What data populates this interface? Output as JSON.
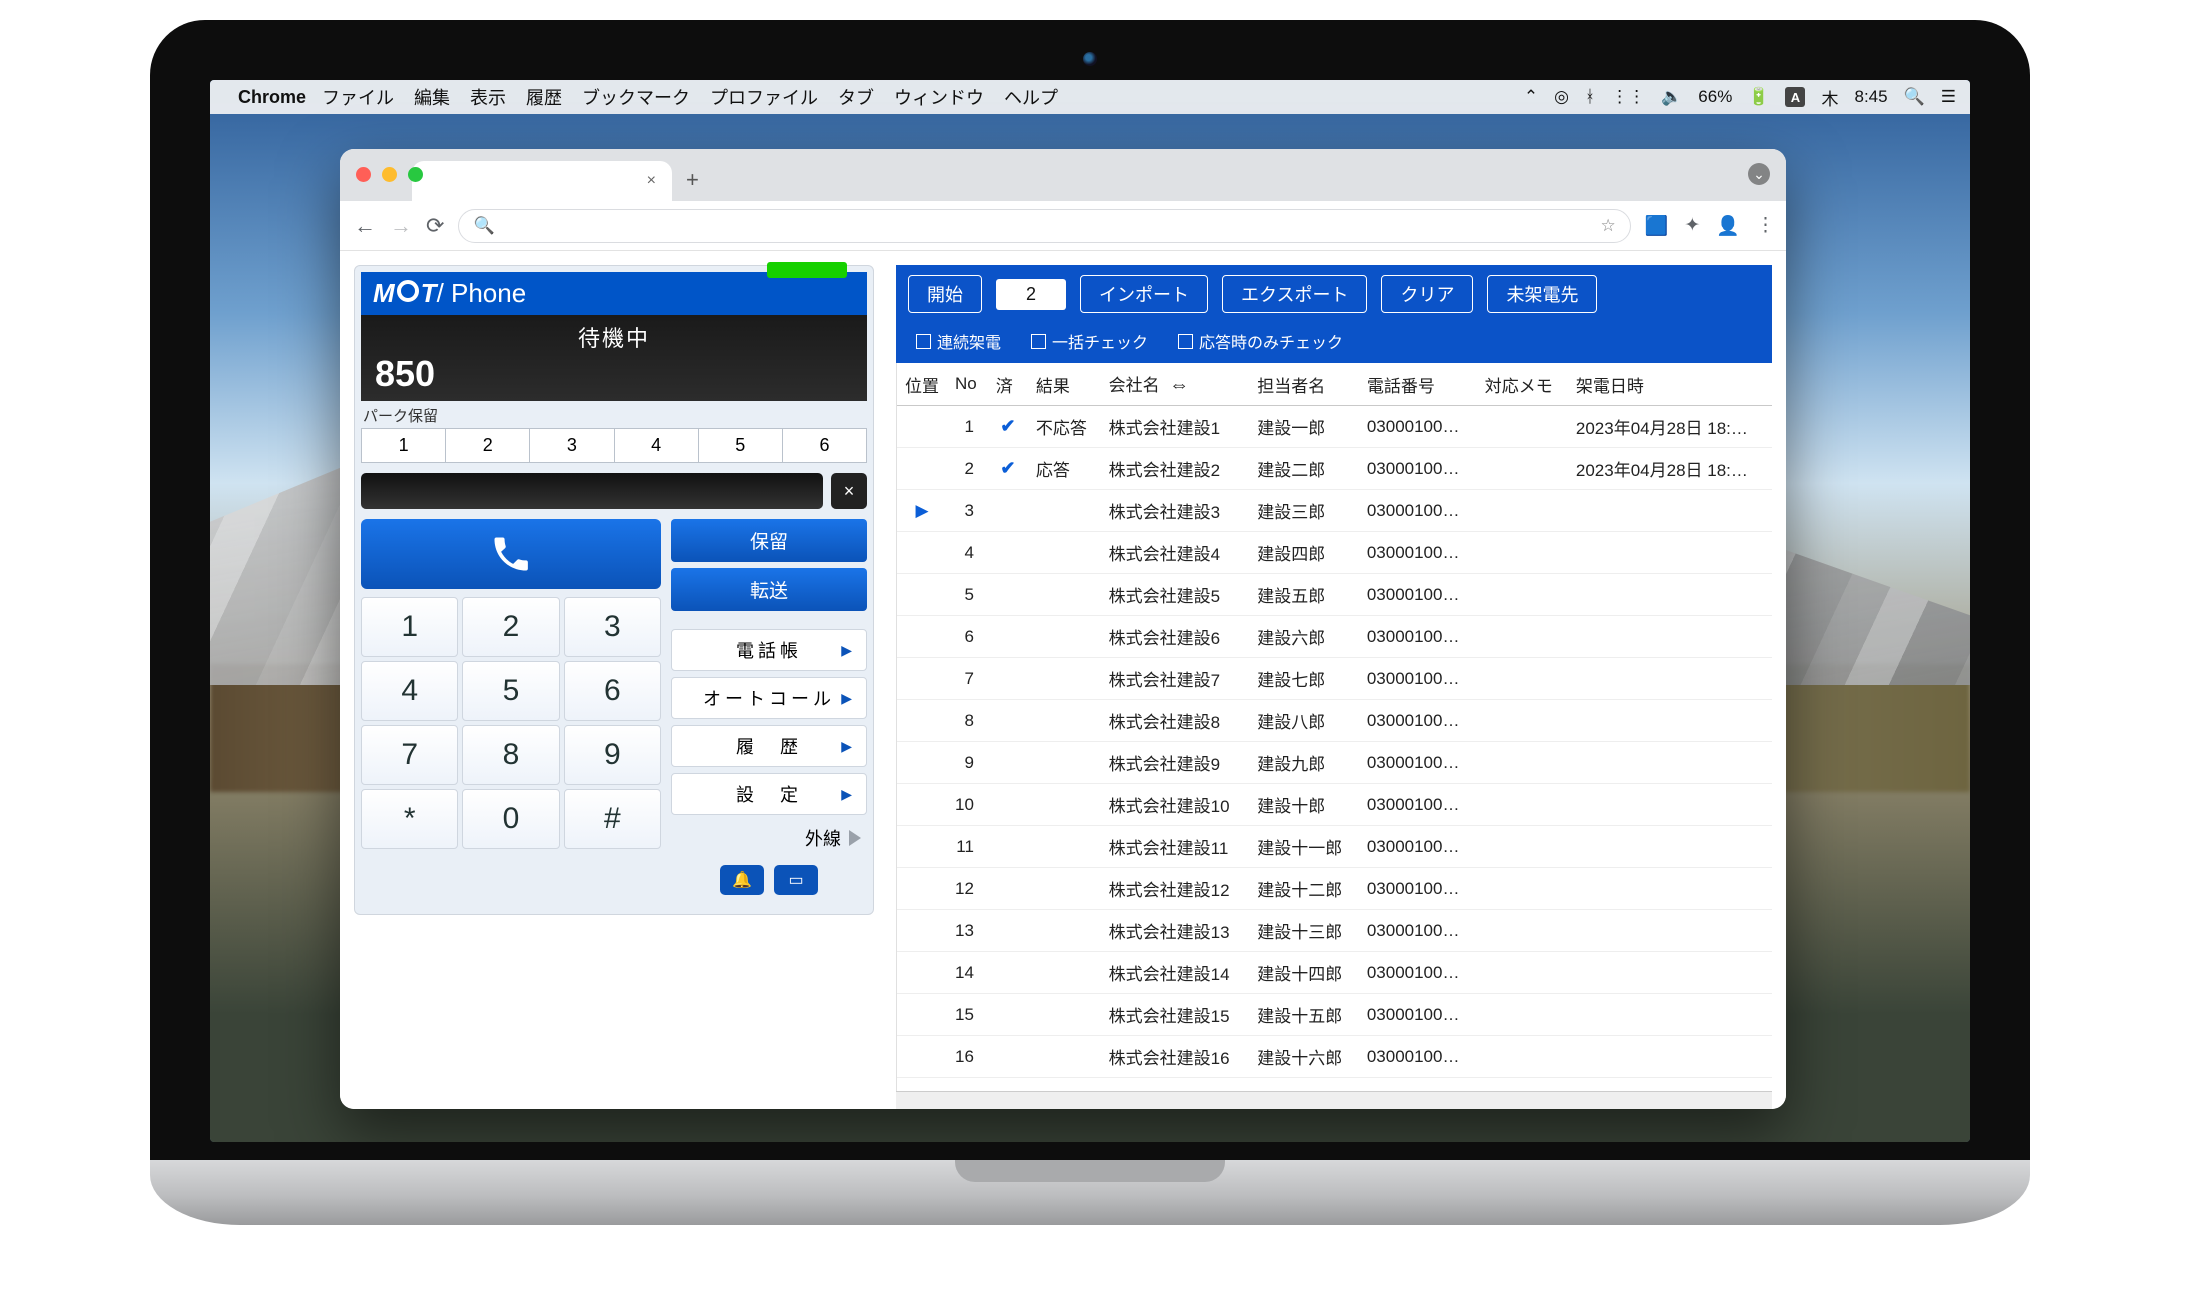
{
  "menubar": {
    "app": "Chrome",
    "menus": [
      "ファイル",
      "編集",
      "表示",
      "履歴",
      "ブックマーク",
      "プロファイル",
      "タブ",
      "ウィンドウ",
      "ヘルプ"
    ],
    "battery": "66%",
    "ime": "A",
    "day": "木",
    "time": "8:45"
  },
  "chrome": {
    "tab_close": "×",
    "newtab": "+",
    "back": "←",
    "forward": "→",
    "reload": "⟳",
    "omnibox_prefix": "Q",
    "omnibox_value": "",
    "star": "☆"
  },
  "phone": {
    "brand_left": "M",
    "brand_mid": "T",
    "brand_right": "/ Phone",
    "status": "待機中",
    "extension": "850",
    "park_label": "パーク保留",
    "park_slots": [
      "1",
      "2",
      "3",
      "4",
      "5",
      "6"
    ],
    "backspace": "×",
    "hold": "保留",
    "transfer": "転送",
    "menu": {
      "phonebook": "電話帳",
      "autocall": "オートコール",
      "history": "履　歴",
      "settings": "設　定"
    },
    "keypad": [
      "1",
      "2",
      "3",
      "4",
      "5",
      "6",
      "7",
      "8",
      "9",
      "*",
      "0",
      "#"
    ],
    "ext_label": "外線",
    "bell": "🔔",
    "book": "📖"
  },
  "list": {
    "buttons": {
      "start": "開始",
      "count": "2",
      "import": "インポート",
      "export": "エクスポート",
      "clear": "クリア",
      "missed": "未架電先"
    },
    "checks": {
      "continuous": "連続架電",
      "bulk": "一括チェック",
      "answered_only": "応答時のみチェック"
    },
    "headers": {
      "pos": "位置",
      "no": "No",
      "done": "済",
      "result": "結果",
      "company": "会社名",
      "swap": "⇔",
      "contact": "担当者名",
      "tel": "電話番号",
      "memo": "対応メモ",
      "datetime": "架電日時"
    },
    "rows": [
      {
        "pos": "",
        "no": "1",
        "done": true,
        "result": "不応答",
        "company": "株式会社建設1",
        "contact": "建設一郎",
        "tel": "03000100…",
        "memo": "",
        "dt": "2023年04月28日 18:…"
      },
      {
        "pos": "",
        "no": "2",
        "done": true,
        "result": "応答",
        "company": "株式会社建設2",
        "contact": "建設二郎",
        "tel": "03000100…",
        "memo": "",
        "dt": "2023年04月28日 18:…"
      },
      {
        "pos": "▶",
        "no": "3",
        "done": false,
        "result": "",
        "company": "株式会社建設3",
        "contact": "建設三郎",
        "tel": "03000100…",
        "memo": "",
        "dt": ""
      },
      {
        "pos": "",
        "no": "4",
        "done": false,
        "result": "",
        "company": "株式会社建設4",
        "contact": "建設四郎",
        "tel": "03000100…",
        "memo": "",
        "dt": ""
      },
      {
        "pos": "",
        "no": "5",
        "done": false,
        "result": "",
        "company": "株式会社建設5",
        "contact": "建設五郎",
        "tel": "03000100…",
        "memo": "",
        "dt": ""
      },
      {
        "pos": "",
        "no": "6",
        "done": false,
        "result": "",
        "company": "株式会社建設6",
        "contact": "建設六郎",
        "tel": "03000100…",
        "memo": "",
        "dt": ""
      },
      {
        "pos": "",
        "no": "7",
        "done": false,
        "result": "",
        "company": "株式会社建設7",
        "contact": "建設七郎",
        "tel": "03000100…",
        "memo": "",
        "dt": ""
      },
      {
        "pos": "",
        "no": "8",
        "done": false,
        "result": "",
        "company": "株式会社建設8",
        "contact": "建設八郎",
        "tel": "03000100…",
        "memo": "",
        "dt": ""
      },
      {
        "pos": "",
        "no": "9",
        "done": false,
        "result": "",
        "company": "株式会社建設9",
        "contact": "建設九郎",
        "tel": "03000100…",
        "memo": "",
        "dt": ""
      },
      {
        "pos": "",
        "no": "10",
        "done": false,
        "result": "",
        "company": "株式会社建設10",
        "contact": "建設十郎",
        "tel": "03000100…",
        "memo": "",
        "dt": ""
      },
      {
        "pos": "",
        "no": "11",
        "done": false,
        "result": "",
        "company": "株式会社建設11",
        "contact": "建設十一郎",
        "tel": "03000100…",
        "memo": "",
        "dt": ""
      },
      {
        "pos": "",
        "no": "12",
        "done": false,
        "result": "",
        "company": "株式会社建設12",
        "contact": "建設十二郎",
        "tel": "03000100…",
        "memo": "",
        "dt": ""
      },
      {
        "pos": "",
        "no": "13",
        "done": false,
        "result": "",
        "company": "株式会社建設13",
        "contact": "建設十三郎",
        "tel": "03000100…",
        "memo": "",
        "dt": ""
      },
      {
        "pos": "",
        "no": "14",
        "done": false,
        "result": "",
        "company": "株式会社建設14",
        "contact": "建設十四郎",
        "tel": "03000100…",
        "memo": "",
        "dt": ""
      },
      {
        "pos": "",
        "no": "15",
        "done": false,
        "result": "",
        "company": "株式会社建設15",
        "contact": "建設十五郎",
        "tel": "03000100…",
        "memo": "",
        "dt": ""
      },
      {
        "pos": "",
        "no": "16",
        "done": false,
        "result": "",
        "company": "株式会社建設16",
        "contact": "建設十六郎",
        "tel": "03000100…",
        "memo": "",
        "dt": ""
      }
    ]
  }
}
